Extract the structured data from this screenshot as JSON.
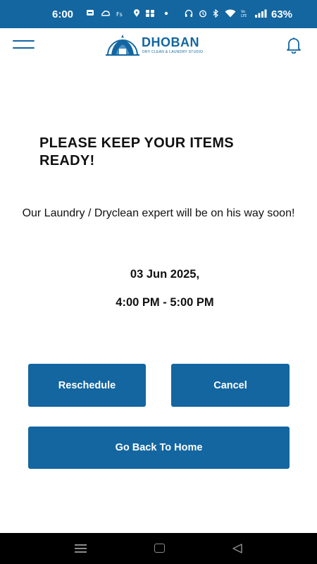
{
  "status_bar": {
    "time": "6:00",
    "battery": "63%",
    "icons": [
      "message-icon",
      "cloud-icon",
      "fs-icon",
      "location-icon",
      "app-icon",
      "dot-icon",
      "headphones-icon",
      "alarm-icon",
      "bluetooth-icon",
      "wifi-icon",
      "volte-icon",
      "signal-icon"
    ]
  },
  "header": {
    "brand": "DHOBAN",
    "tagline": "DRY CLEAN & LAUNDRY STUDIO"
  },
  "main": {
    "headline": "PLEASE KEEP YOUR ITEMS READY!",
    "message": "Our Laundry / Dryclean expert will be on his way soon!",
    "date": "03 Jun 2025,",
    "time_slot": "4:00 PM - 5:00 PM"
  },
  "actions": {
    "reschedule": "Reschedule",
    "cancel": "Cancel",
    "home": "Go Back To Home"
  },
  "colors": {
    "primary": "#1366a0",
    "nav_bar": "#000000"
  }
}
